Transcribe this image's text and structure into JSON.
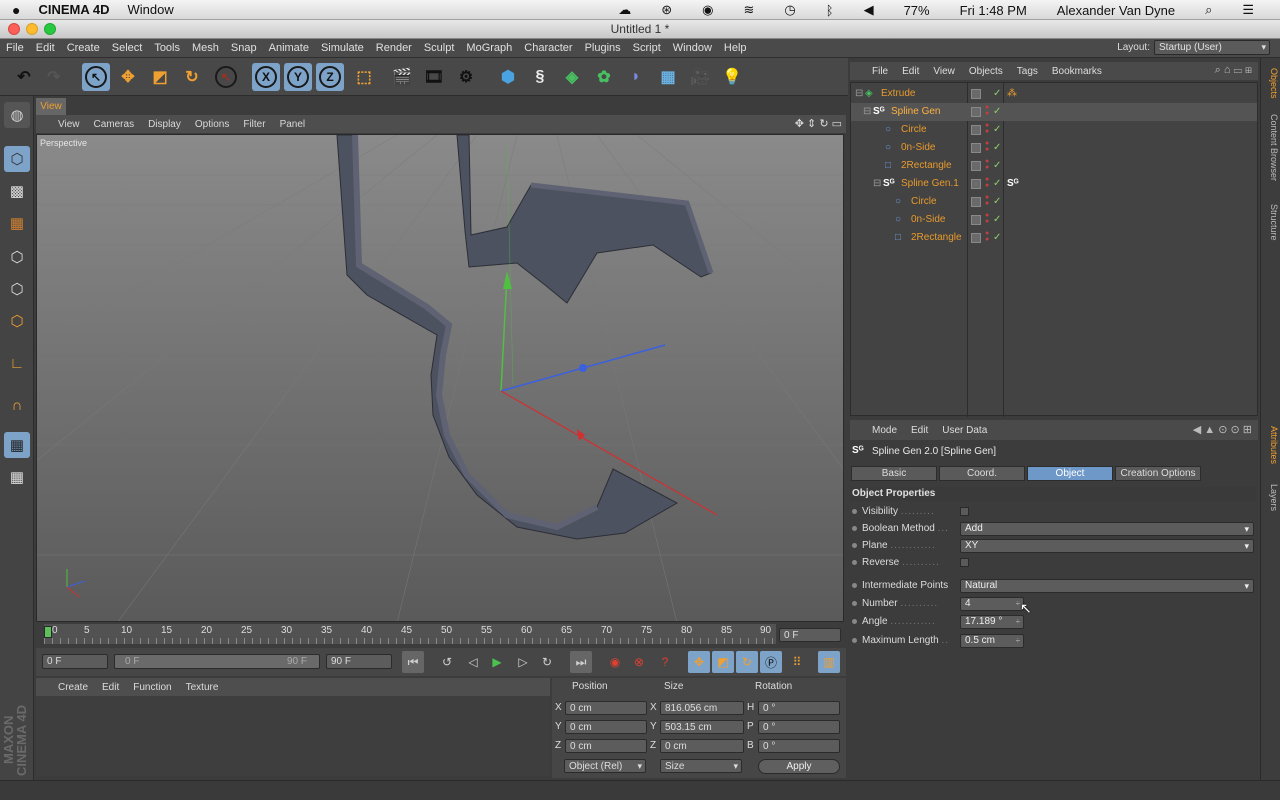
{
  "mac": {
    "app": "CINEMA 4D",
    "menu": [
      "Window"
    ],
    "battery": "77%",
    "clock": "Fri 1:48 PM",
    "user": "Alexander Van Dyne"
  },
  "window": {
    "title": "Untitled 1 *"
  },
  "menu": [
    "File",
    "Edit",
    "Create",
    "Select",
    "Tools",
    "Mesh",
    "Snap",
    "Animate",
    "Simulate",
    "Render",
    "Sculpt",
    "MoGraph",
    "Character",
    "Plugins",
    "Script",
    "Window",
    "Help"
  ],
  "layout": {
    "label": "Layout:",
    "value": "Startup (User)"
  },
  "toolbar": {
    "x": "X",
    "y": "Y",
    "z": "Z"
  },
  "viewport": {
    "tab": "View",
    "menu": [
      "View",
      "Cameras",
      "Display",
      "Options",
      "Filter",
      "Panel"
    ],
    "label": "Perspective"
  },
  "timeline": {
    "ticks": [
      "0",
      "5",
      "10",
      "15",
      "20",
      "25",
      "30",
      "35",
      "40",
      "45",
      "50",
      "55",
      "60",
      "65",
      "70",
      "75",
      "80",
      "85",
      "90"
    ],
    "current_frame": "0 F",
    "start": "0 F",
    "range_start": "0 F",
    "range_end": "90 F",
    "end": "90 F"
  },
  "material": {
    "menu": [
      "Create",
      "Edit",
      "Function",
      "Texture"
    ],
    "logo": "MAXON CINEMA 4D"
  },
  "coordinates": {
    "headers": [
      "Position",
      "Size",
      "Rotation"
    ],
    "rows": [
      {
        "axis": "X",
        "pos": "0 cm",
        "size_axis": "X",
        "size": "816.056 cm",
        "rot_axis": "H",
        "rot": "0 °"
      },
      {
        "axis": "Y",
        "pos": "0 cm",
        "size_axis": "Y",
        "size": "503.15 cm",
        "rot_axis": "P",
        "rot": "0 °"
      },
      {
        "axis": "Z",
        "pos": "0 cm",
        "size_axis": "Z",
        "size": "0 cm",
        "rot_axis": "B",
        "rot": "0 °"
      }
    ],
    "mode": "Object (Rel)",
    "size_mode": "Size",
    "apply": "Apply"
  },
  "objects": {
    "menu": [
      "File",
      "Edit",
      "View",
      "Objects",
      "Tags",
      "Bookmarks"
    ],
    "tree": [
      {
        "name": "Extrude",
        "indent": 0
      },
      {
        "name": "Spline Gen",
        "indent": 1
      },
      {
        "name": "Circle",
        "indent": 2
      },
      {
        "name": "0n-Side",
        "indent": 2
      },
      {
        "name": "2Rectangle",
        "indent": 2
      },
      {
        "name": "Spline Gen.1",
        "indent": 2
      },
      {
        "name": "Circle",
        "indent": 3
      },
      {
        "name": "0n-Side",
        "indent": 3
      },
      {
        "name": "2Rectangle",
        "indent": 3
      }
    ]
  },
  "right_tabs": {
    "top": [
      "Objects",
      "Content Browser",
      "Structure"
    ],
    "bottom": [
      "Attributes",
      "Layers"
    ]
  },
  "attributes": {
    "menu": [
      "Mode",
      "Edit",
      "User Data"
    ],
    "title": "Spline Gen 2.0 [Spline Gen]",
    "tabs": [
      "Basic",
      "Coord.",
      "Object",
      "Creation Options"
    ],
    "active_tab": "Object",
    "section": "Object Properties",
    "props": {
      "visibility": {
        "label": "Visibility"
      },
      "boolean": {
        "label": "Boolean Method",
        "value": "Add"
      },
      "plane": {
        "label": "Plane",
        "value": "XY"
      },
      "reverse": {
        "label": "Reverse"
      },
      "intermediate": {
        "label": "Intermediate Points",
        "value": "Natural"
      },
      "number": {
        "label": "Number",
        "value": "4"
      },
      "angle": {
        "label": "Angle",
        "value": "17.189 °"
      },
      "maxlen": {
        "label": "Maximum Length",
        "value": "0.5 cm"
      }
    }
  },
  "colors": {
    "accent": "#f0a030",
    "selected_tab": "#6e98c8",
    "object_name": "#e89a2c"
  }
}
